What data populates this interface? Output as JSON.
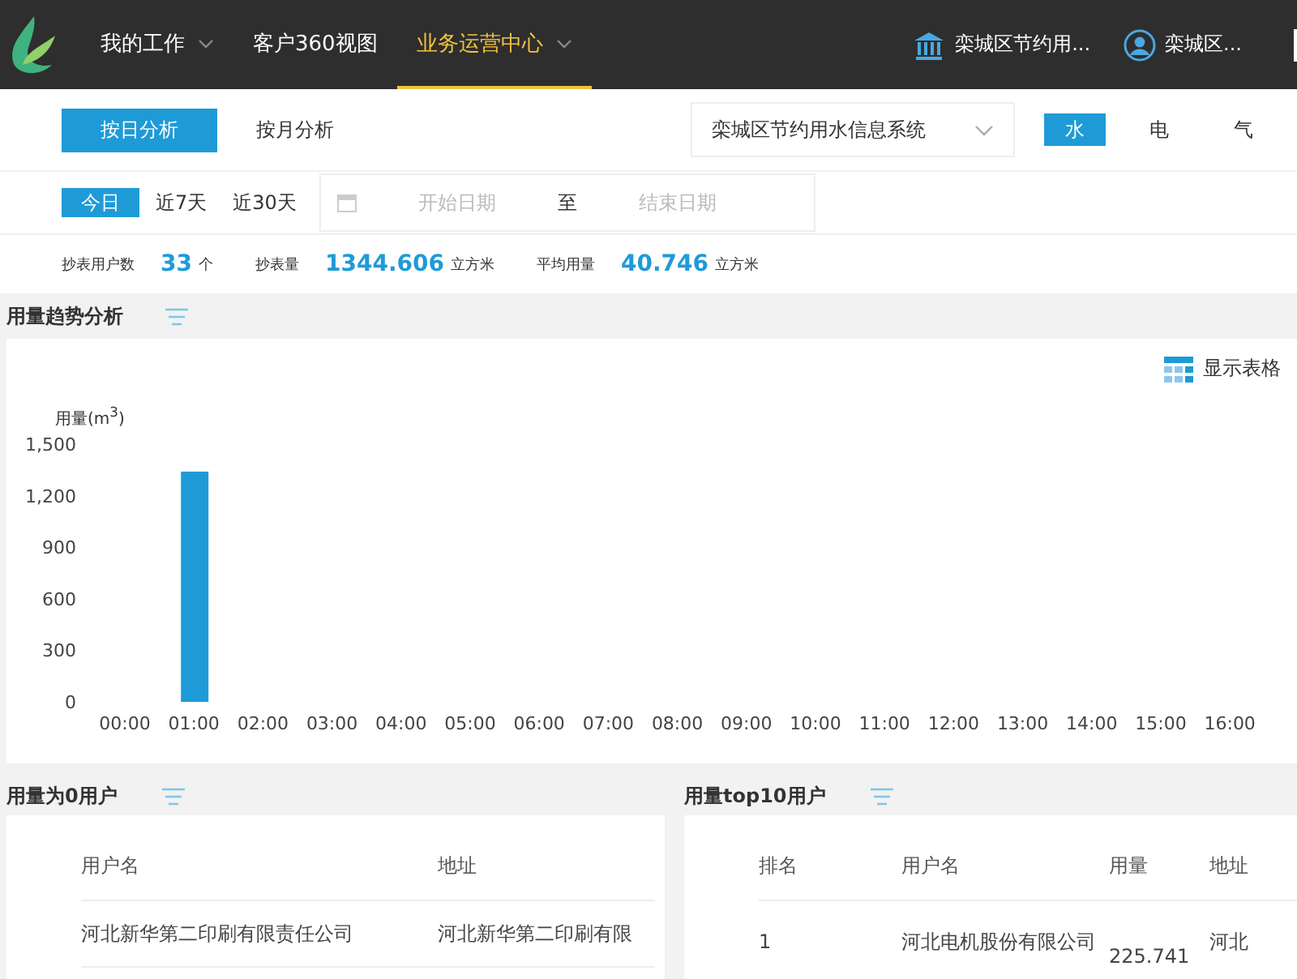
{
  "nav": {
    "items": [
      {
        "label": "我的工作",
        "selected": false,
        "dropdown": true
      },
      {
        "label": "客户360视图",
        "selected": false,
        "dropdown": false
      },
      {
        "label": "业务运营中心",
        "selected": true,
        "dropdown": true
      }
    ],
    "org": "栾城区节约用...",
    "user": "栾城区..."
  },
  "mode_tabs": [
    {
      "label": "按日分析",
      "selected": true
    },
    {
      "label": "按月分析",
      "selected": false
    }
  ],
  "system_select": {
    "value": "栾城区节约用水信息系统"
  },
  "energy_tabs": [
    {
      "label": "水",
      "selected": true
    },
    {
      "label": "电",
      "selected": false
    },
    {
      "label": "气",
      "selected": false
    }
  ],
  "range_tabs": [
    {
      "label": "今日",
      "selected": true
    },
    {
      "label": "近7天",
      "selected": false
    },
    {
      "label": "近30天",
      "selected": false
    }
  ],
  "date_range": {
    "start_placeholder": "开始日期",
    "separator": "至",
    "end_placeholder": "结束日期"
  },
  "stats": [
    {
      "label": "抄表用户数",
      "value": "33",
      "unit": "个"
    },
    {
      "label": "抄表量",
      "value": "1344.606",
      "unit": "立方米"
    },
    {
      "label": "平均用量",
      "value": "40.746",
      "unit": "立方米"
    }
  ],
  "trend": {
    "title": "用量趋势分析",
    "toggle": "显示表格",
    "chart_data": {
      "type": "bar",
      "ylabel": "用量(m$^{3}$)",
      "categories": [
        "00:00",
        "01:00",
        "02:00",
        "03:00",
        "04:00",
        "05:00",
        "06:00",
        "07:00",
        "08:00",
        "09:00",
        "10:00",
        "11:00",
        "12:00",
        "13:00",
        "14:00",
        "15:00",
        "16:00"
      ],
      "series": [
        {
          "color": "#1e9bd7",
          "values": [
            0,
            1340,
            0,
            0,
            0,
            0,
            0,
            0,
            0,
            0,
            0,
            0,
            0,
            0,
            0,
            0,
            0
          ]
        }
      ],
      "ylim": [
        0,
        1500
      ],
      "yticks": [
        {
          "value": 0,
          "label": "0"
        },
        {
          "value": 300,
          "label": "300"
        },
        {
          "value": 600,
          "label": "600"
        },
        {
          "value": 900,
          "label": "900"
        },
        {
          "value": 1200,
          "label": "1,200"
        },
        {
          "value": 1500,
          "label": "1,500"
        }
      ]
    }
  },
  "zero_users": {
    "title": "用量为0用户",
    "columns": [
      "用户名",
      "地址"
    ],
    "rows": [
      [
        "河北新华第二印刷有限责任公司",
        "河北新华第二印刷有限"
      ]
    ]
  },
  "top10": {
    "title": "用量top10用户",
    "columns": [
      "排名",
      "用户名",
      "用量",
      "地址"
    ],
    "rows": [
      [
        "1",
        "河北电机股份有限公司",
        "225.741",
        "河北"
      ]
    ]
  }
}
